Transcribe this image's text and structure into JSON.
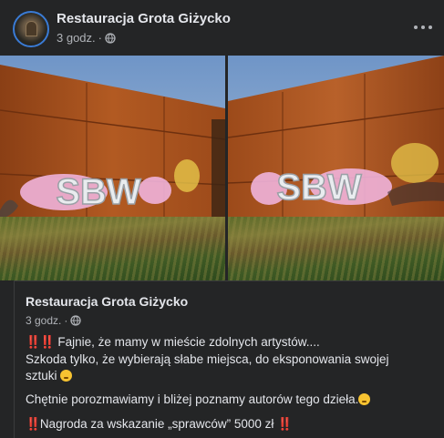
{
  "post": {
    "page_name": "Restauracja Grota Giżycko",
    "time": "3 godz.",
    "sep": "·"
  },
  "caption": {
    "page_name": "Restauracja Grota Giżycko",
    "time": "3 godz.",
    "sep": "·",
    "line1_bang": "‼️‼️",
    "line1": " Fajnie, że mamy w mieście zdolnych artystów....",
    "line2a": "Szkoda tylko, że wybierają słabe miejsca, do eksponowania swojej",
    "line2b": "sztuki ",
    "line3": "Chętnie porozmawiamy i bliżej poznamy autorów tego dzieła.",
    "line4_bang_left": "‼️",
    "line4": "Nagroda za wskazanie „sprawców” 5000 zł ",
    "line4_bang_right": "‼️"
  },
  "photos": {
    "graffiti_text": "SBW"
  },
  "colors": {
    "background": "#242526",
    "wall": "#a24f1c",
    "accent": "#e0245e"
  }
}
